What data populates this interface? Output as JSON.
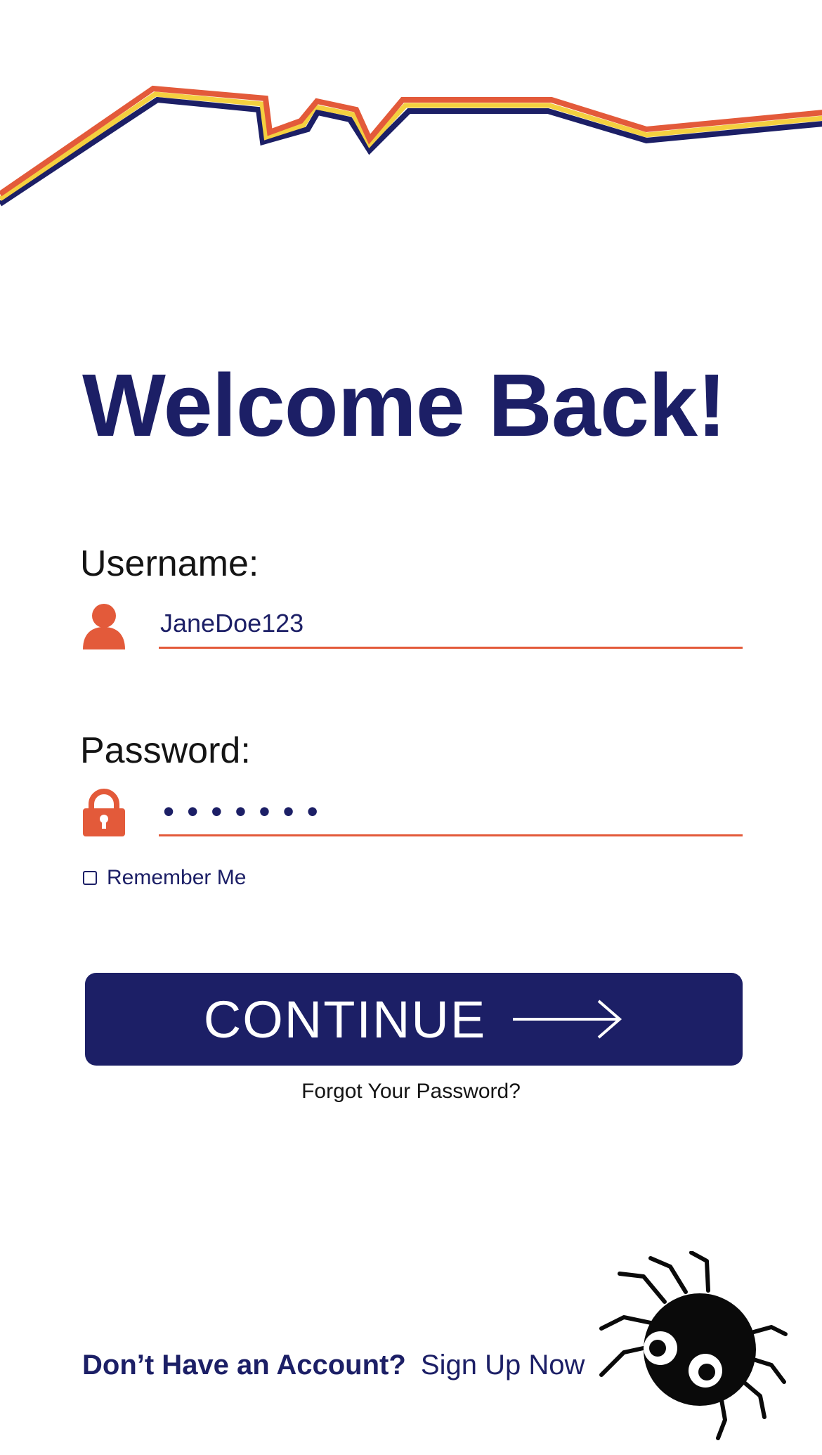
{
  "header": {
    "title": "Welcome Back!"
  },
  "form": {
    "username": {
      "label": "Username:",
      "value": "JaneDoe123",
      "icon": "user-icon"
    },
    "password": {
      "label": "Password:",
      "value": "•••••••",
      "icon": "lock-icon"
    },
    "remember": {
      "label": "Remember Me",
      "checked": false
    },
    "continue_label": "CONTINUE",
    "continue_icon": "arrow-right-icon",
    "forgot_label": "Forgot Your Password?"
  },
  "footer": {
    "question": "Don’t Have an Account?",
    "signup_label": "Sign Up Now",
    "mascot_icon": "spider-icon"
  },
  "colors": {
    "primary": "#1c1f66",
    "accent": "#e35a3a",
    "highlight": "#f4d03f",
    "text": "#141414",
    "background": "#ffffff"
  }
}
